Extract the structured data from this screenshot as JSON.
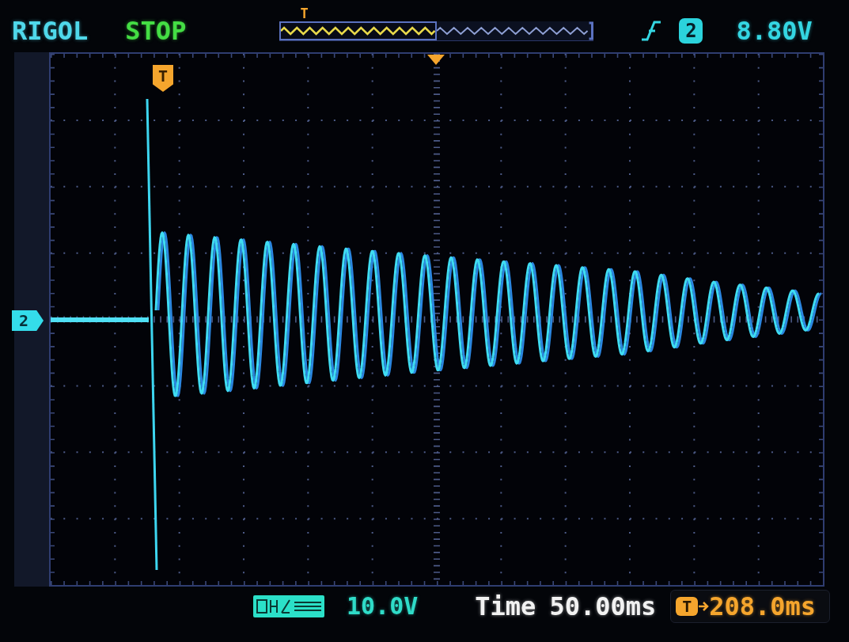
{
  "header": {
    "brand": "RIGOL",
    "run_state": "STOP",
    "memory": {
      "trigger_label": "T",
      "level": 0.5
    },
    "trigger": {
      "source": "2",
      "voltage": "8.80V"
    }
  },
  "display": {
    "trigger_marker": "T",
    "channel_marker": "2"
  },
  "footer": {
    "channel_scale": "10.0V",
    "timebase": {
      "label": "Time",
      "value": "50.00ms"
    },
    "trigger_offset": {
      "marker": "T",
      "value": "208.0ms"
    }
  }
}
